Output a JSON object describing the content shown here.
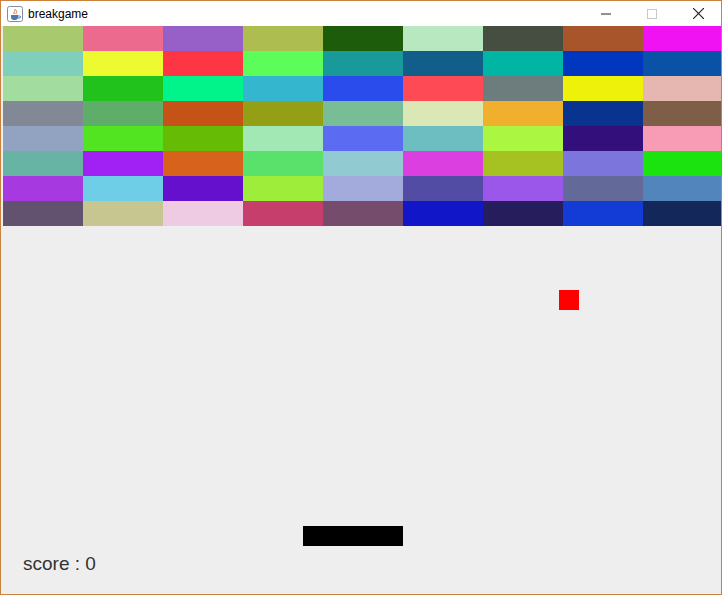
{
  "window": {
    "title": "breakgame",
    "controls": [
      {
        "kind": "minimize",
        "disabled": false
      },
      {
        "kind": "maximize",
        "disabled": true
      },
      {
        "kind": "close",
        "disabled": false
      }
    ]
  },
  "bricks": [
    [
      {
        "color": "#a9c96f"
      },
      {
        "color": "#ec6a8d"
      },
      {
        "color": "#975fc8"
      },
      {
        "color": "#adbd4f"
      },
      {
        "color": "#1c5c0b"
      },
      {
        "color": "#b7e8c0"
      },
      {
        "color": "#464e41"
      },
      {
        "color": "#a9552b"
      },
      {
        "color": "#f012f2"
      }
    ],
    [
      {
        "color": "#7fcfbb"
      },
      {
        "color": "#eefa30"
      },
      {
        "color": "#fd3545"
      },
      {
        "color": "#5cfd5b"
      },
      {
        "color": "#18999a"
      },
      {
        "color": "#115e8b"
      },
      {
        "color": "#01b5a4"
      },
      {
        "color": "#0136be"
      },
      {
        "color": "#0a52a6"
      }
    ],
    [
      {
        "color": "#a2dd9f"
      },
      {
        "color": "#22c21d"
      },
      {
        "color": "#00f48a"
      },
      {
        "color": "#33b6ce"
      },
      {
        "color": "#2a4cec"
      },
      {
        "color": "#fe4a55"
      },
      {
        "color": "#6d7c7c"
      },
      {
        "color": "#eef20a"
      },
      {
        "color": "#e6b6b0"
      }
    ],
    [
      {
        "color": "#828895"
      },
      {
        "color": "#5eae6a"
      },
      {
        "color": "#c55217"
      },
      {
        "color": "#939f14"
      },
      {
        "color": "#79bd97"
      },
      {
        "color": "#dbe7b4"
      },
      {
        "color": "#f0b02e"
      },
      {
        "color": "#08338e"
      },
      {
        "color": "#7f5e47"
      }
    ],
    [
      {
        "color": "#91a3c1"
      },
      {
        "color": "#52e321"
      },
      {
        "color": "#66bb05"
      },
      {
        "color": "#a2e8b4"
      },
      {
        "color": "#5b6cf2"
      },
      {
        "color": "#6dbec0"
      },
      {
        "color": "#aaf640"
      },
      {
        "color": "#320f7a"
      },
      {
        "color": "#f79cb4"
      }
    ],
    [
      {
        "color": "#68b4a4"
      },
      {
        "color": "#a120f4"
      },
      {
        "color": "#d7621b"
      },
      {
        "color": "#59e16b"
      },
      {
        "color": "#91cbd1"
      },
      {
        "color": "#dc3fe0"
      },
      {
        "color": "#a5c222"
      },
      {
        "color": "#7c76dc"
      },
      {
        "color": "#1be30f"
      }
    ],
    [
      {
        "color": "#a63ae0"
      },
      {
        "color": "#6ecde7"
      },
      {
        "color": "#6510cc"
      },
      {
        "color": "#9ded3a"
      },
      {
        "color": "#a3abdc"
      },
      {
        "color": "#524ca4"
      },
      {
        "color": "#9a57e9"
      },
      {
        "color": "#636a99"
      },
      {
        "color": "#5385bd"
      }
    ],
    [
      {
        "color": "#625270"
      },
      {
        "color": "#c7c590"
      },
      {
        "color": "#eecbe2"
      },
      {
        "color": "#c63e6b"
      },
      {
        "color": "#764c6d"
      },
      {
        "color": "#1117c9"
      },
      {
        "color": "#251d5c"
      },
      {
        "color": "#133bd6"
      },
      {
        "color": "#13275b"
      }
    ]
  ],
  "ball": {
    "color": "#ff0000"
  },
  "paddle": {
    "color": "#000000"
  },
  "score": "score : 0"
}
